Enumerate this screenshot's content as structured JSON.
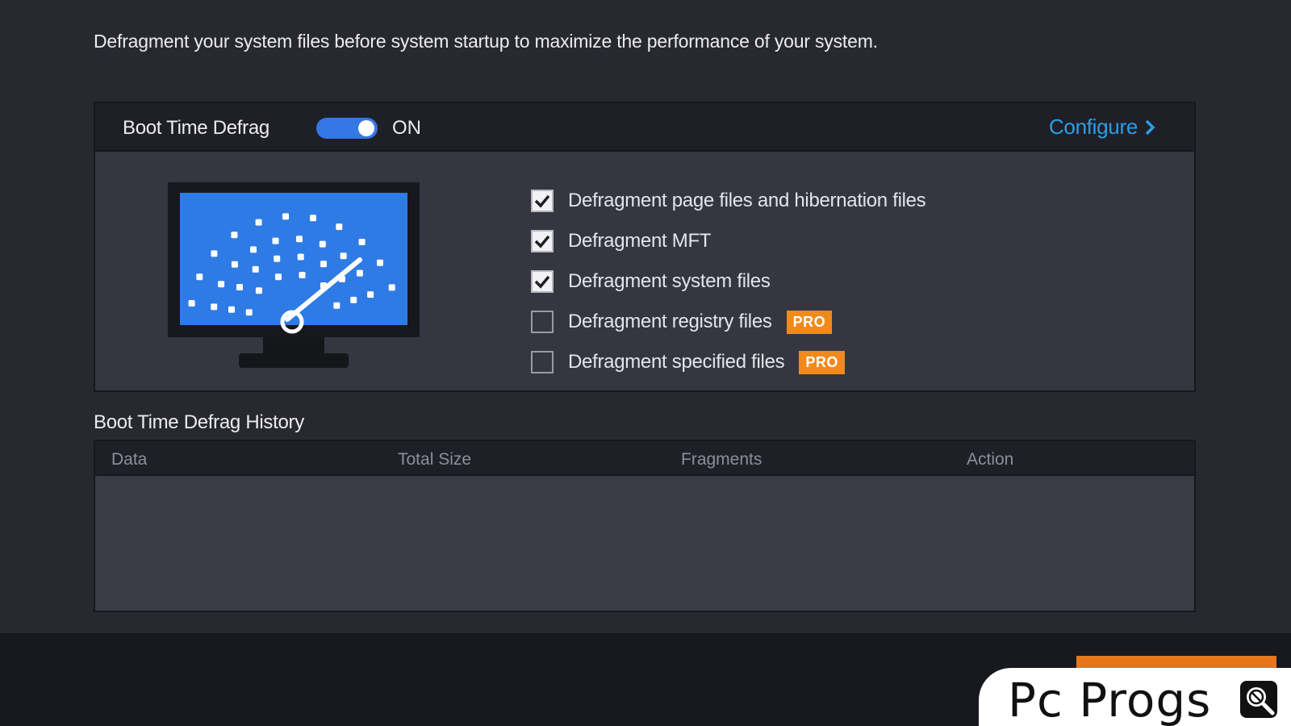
{
  "description": "Defragment your system files before system startup to maximize the performance of your system.",
  "boot_panel": {
    "title": "Boot Time Defrag",
    "toggle_on": true,
    "toggle_state": "ON",
    "configure_label": "Configure",
    "illustration_icon": "monitor-gauge-icon",
    "options": [
      {
        "label": "Defragment page files and hibernation files",
        "checked": true,
        "pro": ""
      },
      {
        "label": "Defragment MFT",
        "checked": true,
        "pro": ""
      },
      {
        "label": "Defragment system files",
        "checked": true,
        "pro": ""
      },
      {
        "label": "Defragment registry files",
        "checked": false,
        "pro": "PRO"
      },
      {
        "label": "Defragment specified files",
        "checked": false,
        "pro": "PRO"
      }
    ]
  },
  "history": {
    "title": "Boot Time Defrag History",
    "columns": [
      "Data",
      "Total Size",
      "Fragments",
      "Action"
    ],
    "rows": []
  },
  "watermark": {
    "text": "Pc Progs",
    "icon": "magnifier-icon"
  },
  "colors": {
    "accent_blue": "#3478e6",
    "link_blue": "#2a9fe6",
    "pro_orange": "#f08a1c",
    "button_orange": "#e6761c",
    "background": "#272830"
  }
}
